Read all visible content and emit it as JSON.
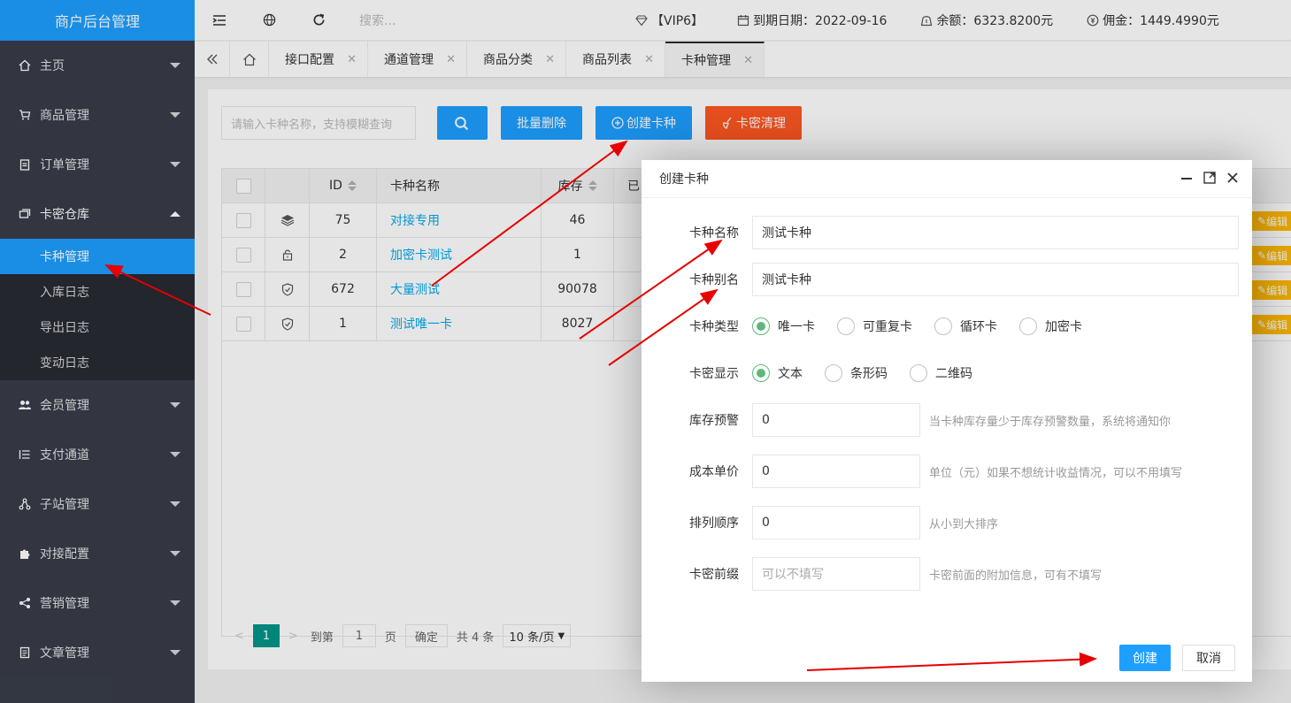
{
  "sidebar": {
    "brand": "商户后台管理",
    "items": [
      {
        "label": "主页"
      },
      {
        "label": "商品管理"
      },
      {
        "label": "订单管理"
      },
      {
        "label": "卡密仓库"
      },
      {
        "label": "会员管理"
      },
      {
        "label": "支付通道"
      },
      {
        "label": "子站管理"
      },
      {
        "label": "对接配置"
      },
      {
        "label": "营销管理"
      },
      {
        "label": "文章管理"
      }
    ],
    "submenu": [
      "卡种管理",
      "入库日志",
      "导出日志",
      "变动日志"
    ]
  },
  "header": {
    "search_placeholder": "搜索...",
    "vip": "【VIP6】",
    "expire": "到期日期：2022-09-16",
    "balance": "余额：6323.8200元",
    "commission": "佣金：1449.4990元"
  },
  "tabs": [
    "接口配置",
    "通道管理",
    "商品分类",
    "商品列表",
    "卡种管理"
  ],
  "toolbar": {
    "search_placeholder": "请输入卡种名称，支持模糊查询",
    "batch_delete": "批量删除",
    "create": "创建卡种",
    "clear": "卡密清理"
  },
  "table": {
    "headers": [
      "ID",
      "卡种名称",
      "库存",
      "已"
    ],
    "rows": [
      {
        "id": "75",
        "name": "对接专用",
        "stock": "46",
        "icon": "layers-icon"
      },
      {
        "id": "2",
        "name": "加密卡测试",
        "stock": "1",
        "icon": "lock-icon"
      },
      {
        "id": "672",
        "name": "大量测试",
        "stock": "90078",
        "icon": "shield-icon"
      },
      {
        "id": "1",
        "name": "测试唯一卡",
        "stock": "8027",
        "icon": "shield-icon"
      }
    ],
    "edit_label": "编辑"
  },
  "pager": {
    "current": "1",
    "goto": "到第",
    "page_input": "1",
    "page_unit": "页",
    "confirm": "确定",
    "total": "共 4 条",
    "per_page": "10 条/页"
  },
  "modal": {
    "title": "创建卡种",
    "name_label": "卡种名称",
    "name_value": "测试卡种",
    "alias_label": "卡种别名",
    "alias_value": "测试卡种",
    "type_label": "卡种类型",
    "type_options": [
      "唯一卡",
      "可重复卡",
      "循环卡",
      "加密卡"
    ],
    "display_label": "卡密显示",
    "display_options": [
      "文本",
      "条形码",
      "二维码"
    ],
    "warn_label": "库存预警",
    "warn_value": "0",
    "warn_hint": "当卡种库存量少于库存预警数量，系统将通知你",
    "cost_label": "成本单价",
    "cost_value": "0",
    "cost_hint": "单位（元）如果不想统计收益情况，可以不用填写",
    "sort_label": "排列顺序",
    "sort_value": "0",
    "sort_hint": "从小到大排序",
    "prefix_label": "卡密前缀",
    "prefix_placeholder": "可以不填写",
    "prefix_hint": "卡密前面的附加信息，可有不填写",
    "create_btn": "创建",
    "cancel_btn": "取消"
  },
  "colors": {
    "accent": "#1e9fff",
    "danger": "#ff5722",
    "sidebar": "#393d49",
    "annotation": "#e60000"
  }
}
